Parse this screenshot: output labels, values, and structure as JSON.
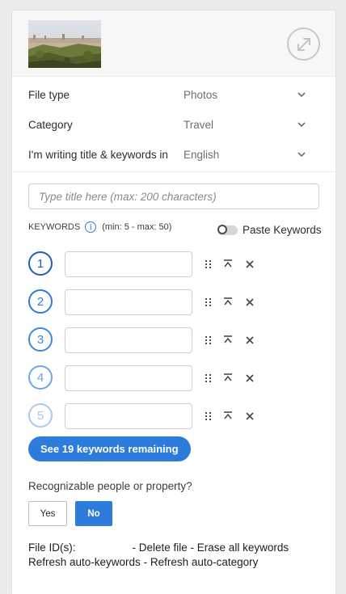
{
  "preview": {
    "thumbnail_icon": "city-landscape-photo",
    "expand_icon": "expand-arrows-icon"
  },
  "meta": {
    "fields": [
      {
        "label": "File type",
        "value": "Photos"
      },
      {
        "label": "Category",
        "value": "Travel"
      },
      {
        "label": "I'm writing title & keywords in",
        "value": "English"
      }
    ]
  },
  "title": {
    "placeholder": "Type title here (max: 200 characters)",
    "value": ""
  },
  "keywords": {
    "header": "KEYWORDS",
    "limits": "(min: 5 - max: 50)",
    "info_glyph": "i",
    "paste_label": "Paste Keywords",
    "paste_enabled": false,
    "rows": [
      {
        "number": "1",
        "value": "",
        "border_color": "#1f5fb8",
        "text_color": "#1f5fb8"
      },
      {
        "number": "2",
        "value": "",
        "border_color": "#2d7cdb",
        "text_color": "#2d7cdb"
      },
      {
        "number": "3",
        "value": "",
        "border_color": "#3d88e0",
        "text_color": "#3d88e0"
      },
      {
        "number": "4",
        "value": "",
        "border_color": "#6da5e6",
        "text_color": "#6da5e6"
      },
      {
        "number": "5",
        "value": "",
        "border_color": "#a9c9f0",
        "text_color": "#a9c9f0"
      }
    ],
    "see_more_label": "See 19 keywords remaining"
  },
  "people": {
    "question": "Recognizable people or property?",
    "yes_label": "Yes",
    "no_label": "No",
    "selected": "No"
  },
  "file_actions": {
    "file_ids_label": "File ID(s):",
    "file_ids_value": "",
    "delete_label": "- Delete file",
    "erase_label": "- Erase all keywords",
    "refresh_keywords_label": "Refresh auto-keywords",
    "refresh_category_label": "- Refresh auto-category"
  },
  "colors": {
    "accent": "#2d7cdb",
    "panel_bg": "#ffffff",
    "page_bg": "#ececec"
  }
}
